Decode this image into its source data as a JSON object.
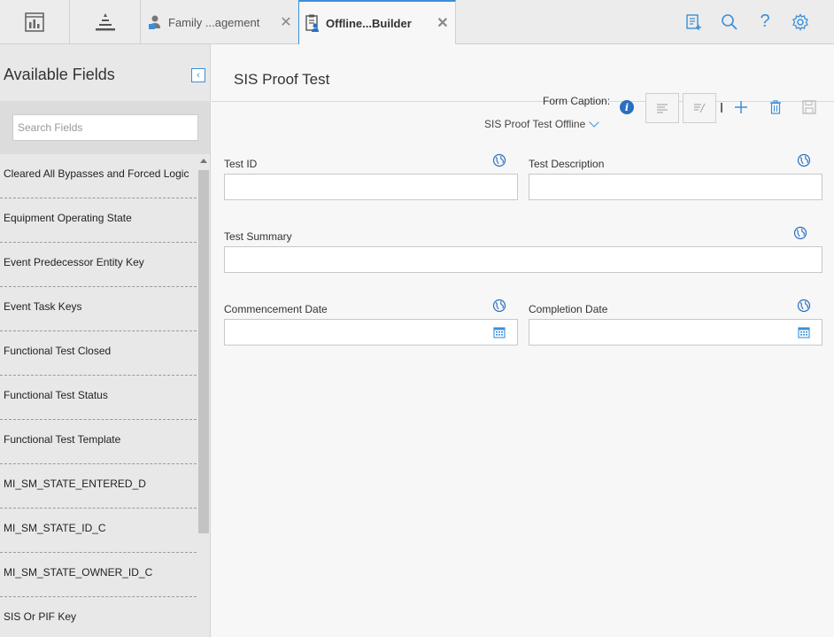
{
  "tabs": [
    {
      "label": "Family ...agement",
      "icon": "family-management-icon",
      "active": false
    },
    {
      "label": "Offline...Builder",
      "icon": "offline-form-builder-icon",
      "active": true
    }
  ],
  "top_tools": [
    "form-add-icon",
    "search-icon",
    "help-icon",
    "settings-icon"
  ],
  "sidebar": {
    "title": "Available Fields",
    "search_placeholder": "Search Fields",
    "items": [
      "Cleared All Bypasses and Forced Logic",
      "Equipment Operating State",
      "Event Predecessor Entity Key",
      "Event Task Keys",
      "Functional Test Closed",
      "Functional Test Status",
      "Functional Test Template",
      "MI_SM_STATE_ENTERED_D",
      "MI_SM_STATE_ID_C",
      "MI_SM_STATE_OWNER_ID_C",
      "SIS Or PIF Key"
    ]
  },
  "main": {
    "title": "SIS Proof Test",
    "form_caption_label": "Form Caption:",
    "form_caption_value": "SIS Proof Test Offline",
    "fields": {
      "test_id": "Test ID",
      "test_description": "Test Description",
      "test_summary": "Test Summary",
      "commencement_date": "Commencement Date",
      "completion_date": "Completion Date"
    }
  },
  "colors": {
    "accent": "#3b8fd8",
    "icon_blue": "#2a6fc0"
  }
}
